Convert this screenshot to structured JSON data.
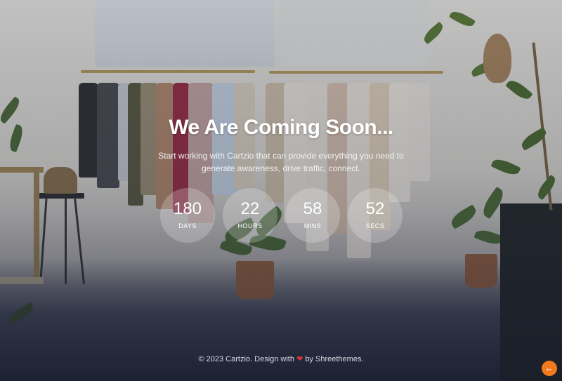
{
  "hero": {
    "title": "We Are Coming Soon...",
    "description_line1": "Start working with Cartzio that can provide everything you need to",
    "description_line2": "generate awareness, drive traffic, connect."
  },
  "countdown": [
    {
      "value": "180",
      "label": "DAYS"
    },
    {
      "value": "22",
      "label": "HOURS"
    },
    {
      "value": "58",
      "label": "MINS"
    },
    {
      "value": "52",
      "label": "SECS"
    }
  ],
  "footer": {
    "prefix": "© 2023 Cartzio. Design with",
    "heart": "❤",
    "suffix": "by Shreethemes."
  },
  "back_to_top": {
    "icon": "arrow-left-icon",
    "glyph": "←",
    "color": "#f07a1c"
  }
}
